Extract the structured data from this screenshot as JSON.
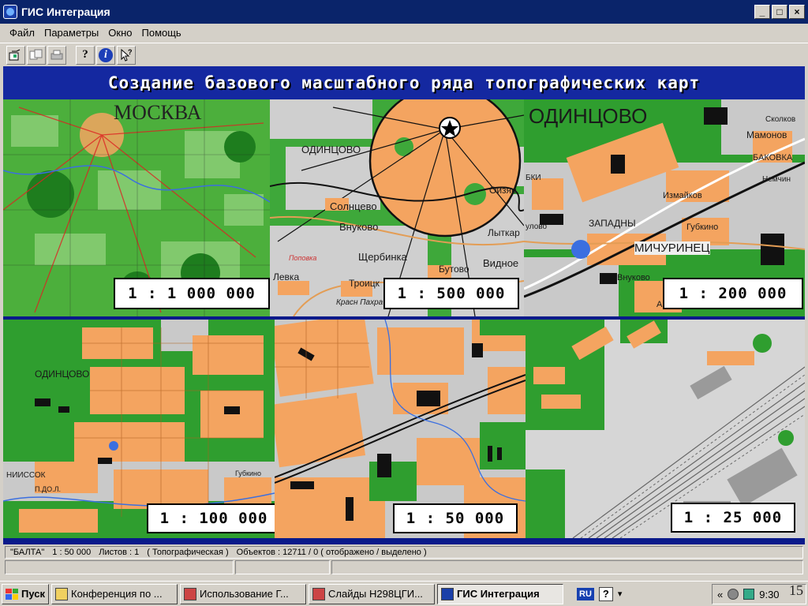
{
  "window": {
    "title": "ГИС Интеграция",
    "min": "_",
    "max": "□",
    "close": "×"
  },
  "menu": [
    "Файл",
    "Параметры",
    "Окно",
    "Помощь"
  ],
  "toolbar": {
    "icons": [
      "open-map-icon",
      "copy-layer-icon",
      "print-icon",
      "help-icon",
      "info-icon",
      "pointer-help-icon"
    ]
  },
  "banner": "Создание базового масштабного ряда топографических карт",
  "tiles": [
    {
      "scale": "1 : 1 000 000",
      "labels": [
        "МОСКВА"
      ]
    },
    {
      "scale": "1 : 500 000",
      "labels": [
        "ОДИНЦОВО",
        "Солнцево",
        "Внуково",
        "Щербинка",
        "Бутово",
        "Видное",
        "Лыткар",
        "Оизяр",
        "Троицк",
        "Левка",
        "Красн Пахра",
        "Поповка"
      ]
    },
    {
      "scale": "1 : 200 000",
      "labels": [
        "ОДИНЦОВО",
        "Мамонов",
        "Сколков",
        "БАКОВКА",
        "ЗАПАДНЫ",
        "МИЧУРИНЕЦ",
        "Внуково",
        "Измайков",
        "Губкино",
        "Немчин",
        "улово",
        "БКИ",
        "Аб"
      ]
    },
    {
      "scale": "1 : 100 000",
      "labels": [
        "ОДИНЦОВО",
        "НИИССОК",
        "П.ДО.Л.",
        "Губкино"
      ]
    },
    {
      "scale": "1 : 50 000",
      "labels": []
    },
    {
      "scale": "1 : 25 000",
      "labels": []
    }
  ],
  "status": {
    "name": "\"БАЛТА\"",
    "scale": "1 : 50 000",
    "sheets": "Листов : 1",
    "type": "( Топографическая )",
    "objects": "Объектов : 12711 / 0 ( отображено / выделено )"
  },
  "taskbar": {
    "start": "Пуск",
    "tasks": [
      {
        "label": "Конференция по ...",
        "icon": "folder-icon",
        "active": false
      },
      {
        "label": "Использование Г...",
        "icon": "powerpoint-icon",
        "active": false
      },
      {
        "label": "Слайды Н298ЦГИ...",
        "icon": "powerpoint-icon",
        "active": false
      },
      {
        "label": "ГИС Интеграция",
        "icon": "gis-app-icon",
        "active": true
      }
    ],
    "lang": "RU",
    "time": "9:30",
    "tray_arrows": "«"
  },
  "slide_number": "15",
  "colors": {
    "urban": "#f4a460",
    "forest": "#2fa82f",
    "open": "#c8c8c8",
    "water": "#3b6fe0",
    "road": "#111111"
  }
}
